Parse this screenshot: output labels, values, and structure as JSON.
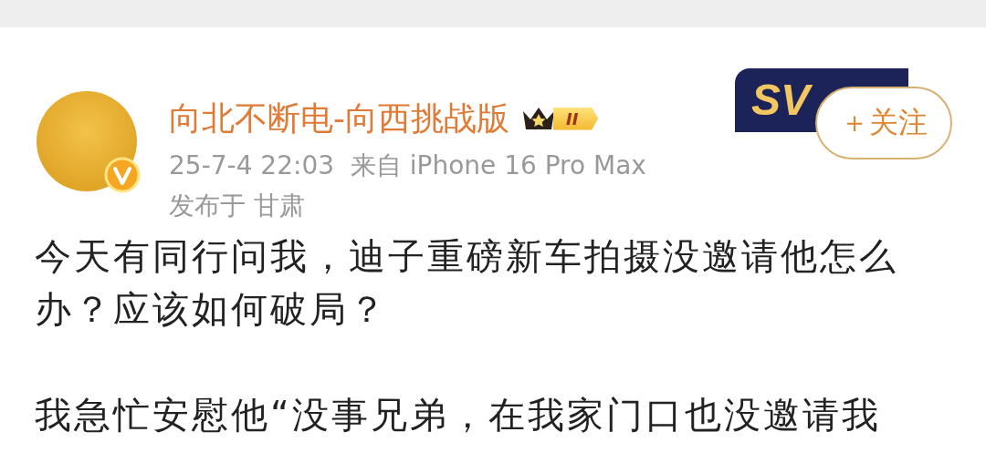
{
  "post": {
    "author": "向北不断电-向西挑战版",
    "level_badge": "II",
    "vip_badge": "SV",
    "follow_button": "＋关注",
    "time": "25-7-4 22:03",
    "source": "来自 iPhone 16 Pro Max",
    "location": "发布于 甘肃",
    "paragraphs": [
      "今天有同行问我，迪子重磅新车拍摄没邀请他怎么办？应该如何破局？",
      "我急忙安慰他“没事兄弟，在我家门口也没邀请我"
    ]
  }
}
